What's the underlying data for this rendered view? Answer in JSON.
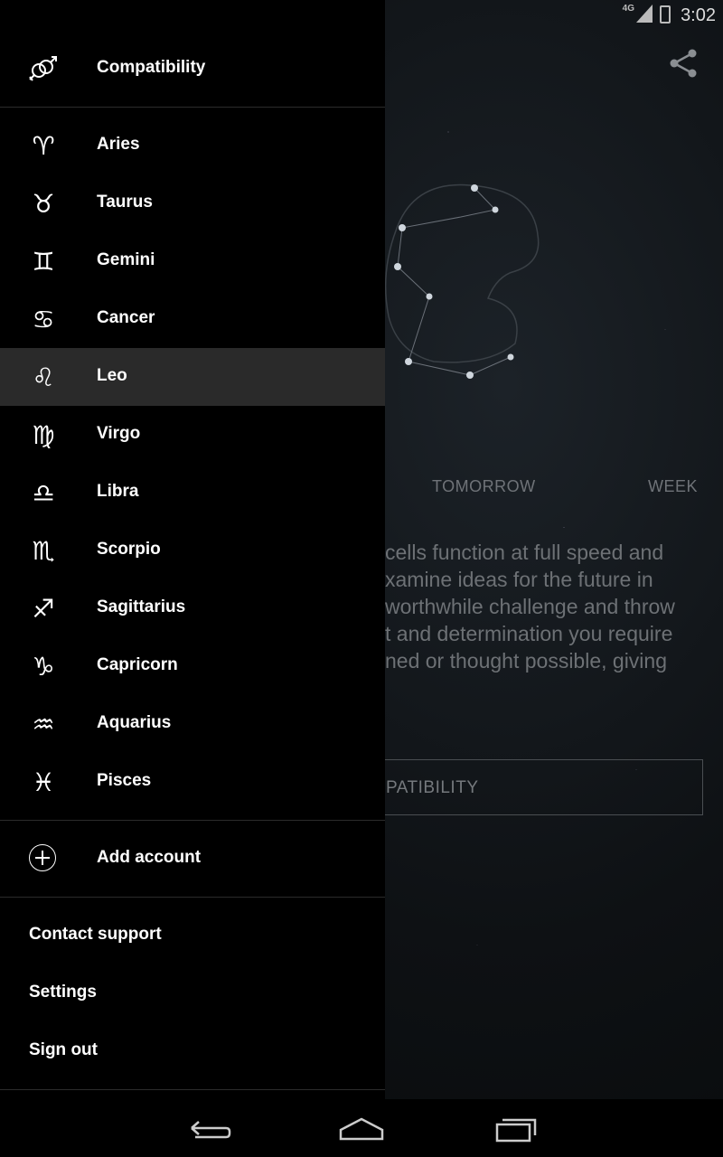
{
  "status_bar": {
    "time": "3:02",
    "network": "4G"
  },
  "background": {
    "tabs": {
      "tomorrow": "TOMORROW",
      "week": "WEEK"
    },
    "horoscope_text": "cells function at full speed and\nxamine ideas for the future in\nworthwhile challenge and throw\nt and determination you require\nned or thought possible, giving",
    "compatibility_button": "PATIBILITY"
  },
  "drawer": {
    "compatibility": {
      "label": "Compatibility",
      "icon": "gender-symbols-icon"
    },
    "signs": [
      {
        "label": "Aries",
        "glyph": "♈︎"
      },
      {
        "label": "Taurus",
        "glyph": "♉︎"
      },
      {
        "label": "Gemini",
        "glyph": "♊︎"
      },
      {
        "label": "Cancer",
        "glyph": "♋︎"
      },
      {
        "label": "Leo",
        "glyph": "♌︎",
        "selected": true
      },
      {
        "label": "Virgo",
        "glyph": "♍︎"
      },
      {
        "label": "Libra",
        "glyph": "♎︎"
      },
      {
        "label": "Scorpio",
        "glyph": "♏︎"
      },
      {
        "label": "Sagittarius",
        "glyph": "♐︎"
      },
      {
        "label": "Capricorn",
        "glyph": "♑︎"
      },
      {
        "label": "Aquarius",
        "glyph": "♒︎"
      },
      {
        "label": "Pisces",
        "glyph": "♓︎"
      }
    ],
    "add_account": "Add account",
    "contact_support": "Contact support",
    "settings": "Settings",
    "sign_out": "Sign out"
  },
  "colors": {
    "selected_row": "#2a2a2a",
    "drawer_bg": "#000000",
    "text": "#ffffff"
  }
}
